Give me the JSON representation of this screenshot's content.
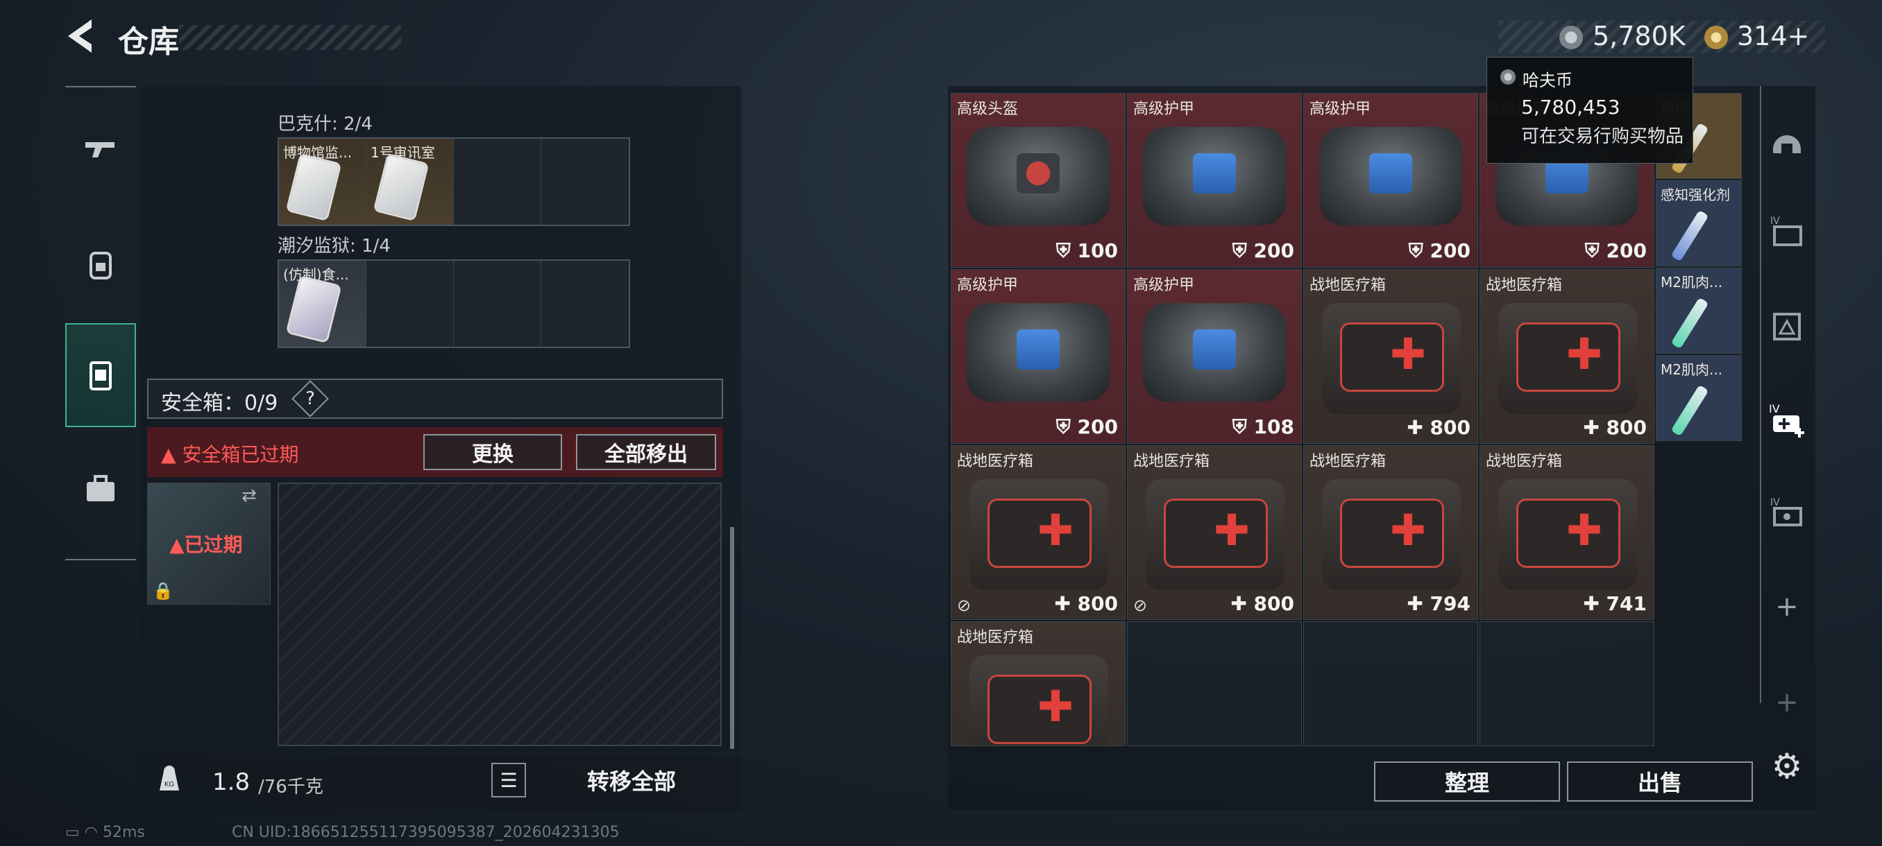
{
  "header": {
    "back_icon": "chevron-left-icon",
    "title": "仓库"
  },
  "currency": {
    "hafcoin": "5,780K",
    "gold": "314+"
  },
  "tooltip": {
    "title": "哈夫币",
    "value": "5,780,453",
    "desc": "可在交易行购买物品"
  },
  "left_nav": [
    "gun-icon",
    "backpack-icon",
    "safebox-icon",
    "toolbox-icon"
  ],
  "keys": {
    "group1_label": "巴克什: 2/4",
    "group1_slots": [
      "博物馆监...",
      "1号审讯室",
      "",
      ""
    ],
    "group2_label": "潮汐监狱: 1/4",
    "group2_slots": [
      "(仿制)食...",
      "",
      "",
      ""
    ]
  },
  "safebox": {
    "label": "安全箱：0/9",
    "help": "?",
    "warning": "安全箱已过期",
    "swap": "更换",
    "remove_all": "全部移出",
    "case_status": "已过期"
  },
  "bottom_left": {
    "weight": "1.8",
    "capacity": "/76千克",
    "transfer_all": "转移全部"
  },
  "status": {
    "ping": "52ms",
    "uid": "CN UID:18665125511739509538​7_202604231305"
  },
  "inventory": [
    {
      "name": "高级头盔",
      "value": "100",
      "kind": "armor",
      "color": "red",
      "logo": "red"
    },
    {
      "name": "高级护甲",
      "value": "200",
      "kind": "armor",
      "color": "red",
      "logo": "blue"
    },
    {
      "name": "高级护甲",
      "value": "200",
      "kind": "armor",
      "color": "red",
      "logo": "blue"
    },
    {
      "name": "高级护甲",
      "value": "200",
      "kind": "armor",
      "color": "red",
      "logo": "blue"
    },
    {
      "name": "高级护甲",
      "value": "200",
      "kind": "armor",
      "color": "red",
      "logo": "blue"
    },
    {
      "name": "高级护甲",
      "value": "108",
      "kind": "armor",
      "color": "red",
      "logo": "blue"
    },
    {
      "name": "战地医疗箱",
      "value": "800",
      "kind": "medkit",
      "color": "brown"
    },
    {
      "name": "战地医疗箱",
      "value": "800",
      "kind": "medkit",
      "color": "brown"
    },
    {
      "name": "战地医疗箱",
      "value": "800",
      "kind": "medkit",
      "color": "brown",
      "tag": "no-insure-icon"
    },
    {
      "name": "战地医疗箱",
      "value": "800",
      "kind": "medkit",
      "color": "brown",
      "tag": "no-insure-icon"
    },
    {
      "name": "战地医疗箱",
      "value": "794",
      "kind": "medkit",
      "color": "brown"
    },
    {
      "name": "战地医疗箱",
      "value": "741",
      "kind": "medkit",
      "color": "brown"
    },
    {
      "name": "战地医疗箱",
      "value": "",
      "kind": "medkit",
      "color": "brown"
    }
  ],
  "side_items": [
    {
      "name": "铸棒",
      "color": "#5a4a30"
    },
    {
      "name": "感知强化剂",
      "color": "#2e3b52"
    },
    {
      "name": "M2肌肉...",
      "color": "#2e3b52"
    },
    {
      "name": "M2肌肉...",
      "color": "#2e3b52"
    }
  ],
  "right_nav": [
    "helmet-icon",
    "folder-icon",
    "map-icon",
    "medkit-add-icon",
    "id-card-icon",
    "plus-icon",
    "plus-icon"
  ],
  "bottom_right": {
    "sort": "整理",
    "sell": "出售"
  }
}
